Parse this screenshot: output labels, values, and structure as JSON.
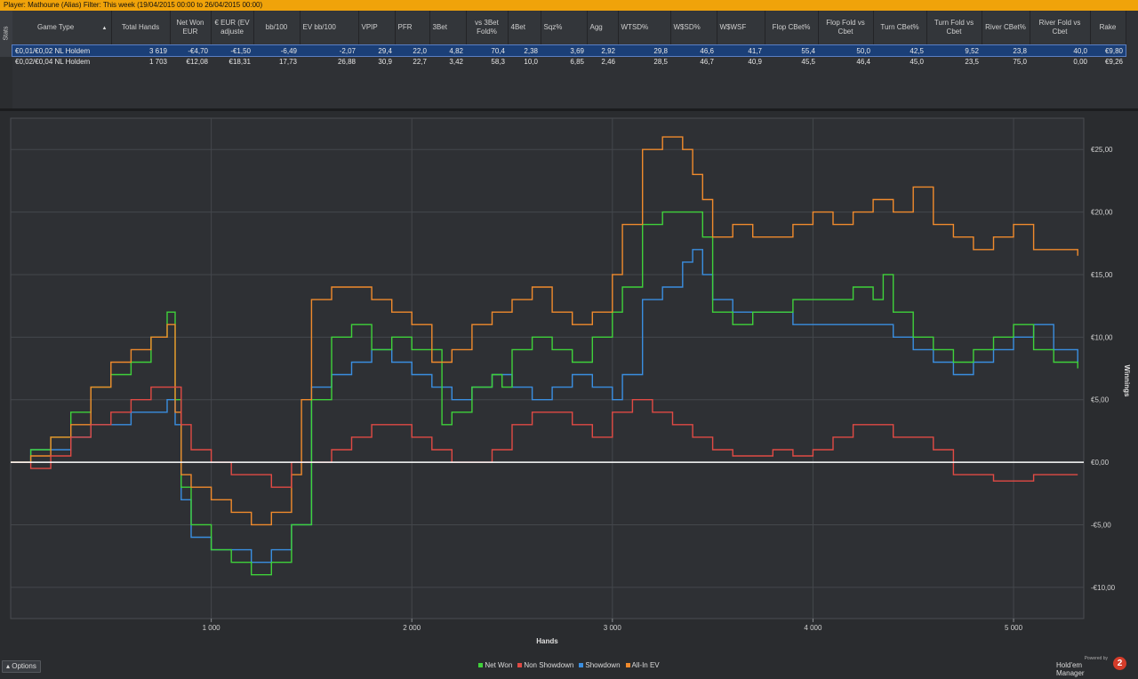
{
  "header": {
    "text": "Player: Mathoune (Alias)   Filter: This week (19/04/2015 00:00 to 26/04/2015 00:00)"
  },
  "side_tab": {
    "label": "Stats"
  },
  "table": {
    "columns": [
      {
        "key": "game",
        "label": "Game Type",
        "sorted": true
      },
      {
        "key": "hands",
        "label": "Total Hands"
      },
      {
        "key": "netwon",
        "label": "Net Won EUR"
      },
      {
        "key": "ev",
        "label": "€ EUR (EV adjuste"
      },
      {
        "key": "bb100",
        "label": "bb/100"
      },
      {
        "key": "evbb",
        "label": "EV bb/100"
      },
      {
        "key": "vpip",
        "label": "VPIP"
      },
      {
        "key": "pfr",
        "label": "PFR"
      },
      {
        "key": "3bet",
        "label": "3Bet"
      },
      {
        "key": "vs3bet",
        "label": "vs 3Bet Fold%"
      },
      {
        "key": "4bet",
        "label": "4Bet"
      },
      {
        "key": "sqz",
        "label": "Sqz%"
      },
      {
        "key": "agg",
        "label": "Agg"
      },
      {
        "key": "wtsd",
        "label": "WTSD%"
      },
      {
        "key": "wsd",
        "label": "W$SD%"
      },
      {
        "key": "wwsf",
        "label": "W$WSF"
      },
      {
        "key": "flopcb",
        "label": "Flop CBet%"
      },
      {
        "key": "flopfold",
        "label": "Flop Fold vs Cbet"
      },
      {
        "key": "turncb",
        "label": "Turn CBet%"
      },
      {
        "key": "turnfold",
        "label": "Turn Fold vs Cbet"
      },
      {
        "key": "rivercb",
        "label": "River CBet%"
      },
      {
        "key": "riverfold",
        "label": "River Fold vs Cbet"
      },
      {
        "key": "rake",
        "label": "Rake"
      }
    ],
    "rows": [
      [
        "€0,01/€0,02 NL Holdem",
        "3 619",
        "-€4,70",
        "-€1,50",
        "-6,49",
        "-2,07",
        "29,4",
        "22,0",
        "4,82",
        "70,4",
        "2,38",
        "3,69",
        "2,92",
        "29,8",
        "46,6",
        "41,7",
        "55,4",
        "50,0",
        "42,5",
        "9,52",
        "23,8",
        "40,0",
        "€9,80"
      ],
      [
        "€0,02/€0,04 NL Holdem",
        "1 703",
        "€12,08",
        "€18,31",
        "17,73",
        "26,88",
        "30,9",
        "22,7",
        "3,42",
        "58,3",
        "10,0",
        "6,85",
        "2,46",
        "28,5",
        "46,7",
        "40,9",
        "45,5",
        "46,4",
        "45,0",
        "23,5",
        "75,0",
        "0,00",
        "€9,26"
      ]
    ]
  },
  "options_label": "Options",
  "brand": {
    "small": "Powered by",
    "name": "Hold'em Manager",
    "logo": "2"
  },
  "colors": {
    "net_won": "#3fd13a",
    "non_showdown": "#e04a44",
    "showdown": "#3a8ee0",
    "all_in_ev": "#f08a2c",
    "zero_line": "#ffffff"
  },
  "chart_data": {
    "type": "line",
    "xlabel": "Hands",
    "ylabel": "Winnings",
    "xlim": [
      0,
      5350
    ],
    "ylim": [
      -12.5,
      27.5
    ],
    "x_ticks": [
      1000,
      2000,
      3000,
      4000,
      5000
    ],
    "x_tick_labels": [
      "1 000",
      "2 000",
      "3 000",
      "4 000",
      "5 000"
    ],
    "y_ticks": [
      -10,
      -5,
      0,
      5,
      10,
      15,
      20,
      25
    ],
    "y_tick_labels": [
      "-€10,00",
      "-€5,00",
      "€0,00",
      "€5,00",
      "€10,00",
      "€15,00",
      "€20,00",
      "€25,00"
    ],
    "legend_position": "bottom-center",
    "grid": true,
    "series": [
      {
        "name": "Net Won",
        "color": "#3fd13a",
        "x": [
          0,
          100,
          200,
          300,
          400,
          500,
          600,
          700,
          780,
          820,
          850,
          900,
          1000,
          1100,
          1200,
          1300,
          1400,
          1450,
          1500,
          1600,
          1700,
          1800,
          1900,
          2000,
          2150,
          2200,
          2300,
          2400,
          2450,
          2500,
          2600,
          2700,
          2800,
          2900,
          3000,
          3050,
          3150,
          3250,
          3350,
          3450,
          3500,
          3600,
          3700,
          3800,
          3900,
          4000,
          4100,
          4200,
          4300,
          4350,
          4400,
          4500,
          4600,
          4700,
          4800,
          4900,
          5000,
          5100,
          5200,
          5320
        ],
        "y": [
          0,
          1,
          2,
          4,
          6,
          7,
          8,
          10,
          12,
          5,
          -2,
          -5,
          -7,
          -8,
          -9,
          -8,
          -5,
          -5,
          5,
          10,
          11,
          9,
          10,
          9,
          3,
          4,
          6,
          7,
          6,
          9,
          10,
          9,
          8,
          10,
          12,
          14,
          19,
          20,
          20,
          18,
          12,
          11,
          12,
          12,
          13,
          13,
          13,
          14,
          13,
          15,
          12,
          10,
          9,
          8,
          9,
          10,
          11,
          9,
          8,
          7.5
        ]
      },
      {
        "name": "Non Showdown",
        "color": "#e04a44",
        "x": [
          0,
          100,
          200,
          300,
          400,
          500,
          600,
          700,
          800,
          850,
          900,
          1000,
          1100,
          1200,
          1300,
          1400,
          1500,
          1600,
          1700,
          1800,
          1900,
          2000,
          2100,
          2200,
          2300,
          2400,
          2500,
          2600,
          2700,
          2800,
          2900,
          3000,
          3100,
          3200,
          3300,
          3400,
          3500,
          3600,
          3700,
          3800,
          3900,
          4000,
          4100,
          4200,
          4300,
          4400,
          4500,
          4600,
          4700,
          4800,
          4900,
          5000,
          5100,
          5200,
          5320
        ],
        "y": [
          0,
          -0.5,
          0.5,
          2,
          3,
          4,
          5,
          6,
          6,
          3,
          1,
          0,
          -1,
          -1,
          -2,
          0,
          0,
          1,
          2,
          3,
          3,
          2,
          1,
          0,
          0,
          1,
          3,
          4,
          4,
          3,
          2,
          4,
          5,
          4,
          3,
          2,
          1,
          0.5,
          0.5,
          1,
          0.5,
          1,
          2,
          3,
          3,
          2,
          2,
          1,
          -1,
          -1,
          -1.5,
          -1.5,
          -1,
          -1,
          -1
        ]
      },
      {
        "name": "Showdown",
        "color": "#3a8ee0",
        "x": [
          0,
          100,
          200,
          300,
          400,
          500,
          600,
          700,
          780,
          820,
          850,
          900,
          1000,
          1100,
          1200,
          1300,
          1400,
          1500,
          1600,
          1700,
          1800,
          1900,
          2000,
          2100,
          2200,
          2300,
          2400,
          2500,
          2600,
          2700,
          2800,
          2900,
          3000,
          3050,
          3150,
          3250,
          3350,
          3400,
          3450,
          3500,
          3600,
          3700,
          3800,
          3900,
          4000,
          4100,
          4200,
          4300,
          4400,
          4500,
          4600,
          4700,
          4800,
          4900,
          5000,
          5100,
          5200,
          5320
        ],
        "y": [
          0,
          1,
          1,
          2,
          3,
          3,
          4,
          4,
          5,
          3,
          -3,
          -6,
          -7,
          -7,
          -8,
          -7,
          -5,
          6,
          7,
          8,
          9,
          8,
          7,
          6,
          5,
          6,
          7,
          6,
          5,
          6,
          7,
          6,
          5,
          7,
          13,
          14,
          16,
          17,
          15,
          13,
          12,
          12,
          12,
          11,
          11,
          11,
          11,
          11,
          10,
          9,
          8,
          7,
          8,
          9,
          10,
          11,
          9,
          8
        ]
      },
      {
        "name": "All-In EV",
        "color": "#f08a2c",
        "x": [
          0,
          100,
          200,
          300,
          400,
          500,
          600,
          700,
          780,
          820,
          850,
          900,
          1000,
          1100,
          1200,
          1300,
          1400,
          1450,
          1500,
          1600,
          1700,
          1800,
          1900,
          2000,
          2100,
          2200,
          2300,
          2400,
          2500,
          2600,
          2700,
          2800,
          2900,
          3000,
          3050,
          3150,
          3250,
          3350,
          3400,
          3450,
          3500,
          3600,
          3700,
          3800,
          3900,
          4000,
          4100,
          4200,
          4300,
          4400,
          4500,
          4600,
          4700,
          4800,
          4900,
          5000,
          5100,
          5200,
          5320
        ],
        "y": [
          0,
          0.5,
          2,
          3,
          6,
          8,
          9,
          10,
          11,
          4,
          -1,
          -2,
          -3,
          -4,
          -5,
          -4,
          -1,
          5,
          13,
          14,
          14,
          13,
          12,
          11,
          8,
          9,
          11,
          12,
          13,
          14,
          12,
          11,
          12,
          15,
          19,
          25,
          26,
          25,
          23,
          21,
          18,
          19,
          18,
          18,
          19,
          20,
          19,
          20,
          21,
          20,
          22,
          19,
          18,
          17,
          18,
          19,
          17,
          17,
          16.5
        ]
      }
    ]
  }
}
